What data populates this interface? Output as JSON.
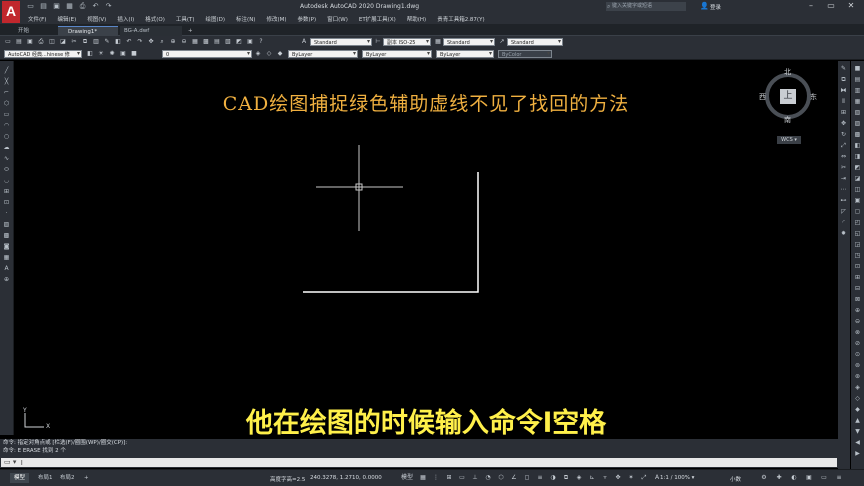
{
  "titlebar": {
    "app_logo": "A",
    "window_title": "Autodesk AutoCAD 2020    Drawing1.dwg",
    "search_placeholder": "键入关键字或短语",
    "login_label": "登录",
    "qa_icons": [
      "new-icon",
      "open-icon",
      "save-icon",
      "saveas-icon",
      "print-icon",
      "undo-icon",
      "redo-icon"
    ]
  },
  "menu": {
    "items": [
      "文件(F)",
      "编辑(E)",
      "视图(V)",
      "插入(I)",
      "格式(O)",
      "工具(T)",
      "绘图(D)",
      "标注(N)",
      "修改(M)",
      "参数(P)",
      "窗口(W)",
      "ET扩展工具(X)",
      "帮助(H)",
      "贵青工具箱2.87(Y)"
    ]
  },
  "tabs": {
    "start": "开始",
    "drawing1": "Drawing1*",
    "bg": "BG-A.dwf",
    "add": "+"
  },
  "toolbar1": {
    "text_style": "Standard",
    "dim_style": "副本 ISO-25",
    "table_style": "Standard",
    "mleader_style": "Standard"
  },
  "toolbar2": {
    "workspace": "AutoCAD 经典...hinese 修",
    "layer": "0",
    "color": "ByLayer",
    "linetype": "ByLayer",
    "lineweight": "ByLayer",
    "plotstyle": "ByColor"
  },
  "canvas": {
    "video_title": "CAD绘图捕捉绿色辅助虚线不见了找回的方法",
    "subtitle": "他在绘图的时候输入命令l空格",
    "ucs_x": "X",
    "ucs_y": "Y"
  },
  "viewcube": {
    "north": "北",
    "south": "南",
    "east": "东",
    "west": "西",
    "face": "上",
    "wcs": "WCS ▾"
  },
  "command": {
    "history": [
      "命令: 指定对角点或 [栏选(F)/圈围(WP)/圈交(CP)]:",
      "命令: E ERASE 找到 2 个"
    ],
    "input_value": "l"
  },
  "statusbar": {
    "model_tab": "模型",
    "layout1": "布局1",
    "layout2": "布局2",
    "add_layout": "+",
    "readout": "高度字高=2.5",
    "coords": "240.3278, 1.2710, 0.0000",
    "mode": "模型",
    "scale": "1:1 / 100% ▾",
    "small_label": "小数"
  }
}
